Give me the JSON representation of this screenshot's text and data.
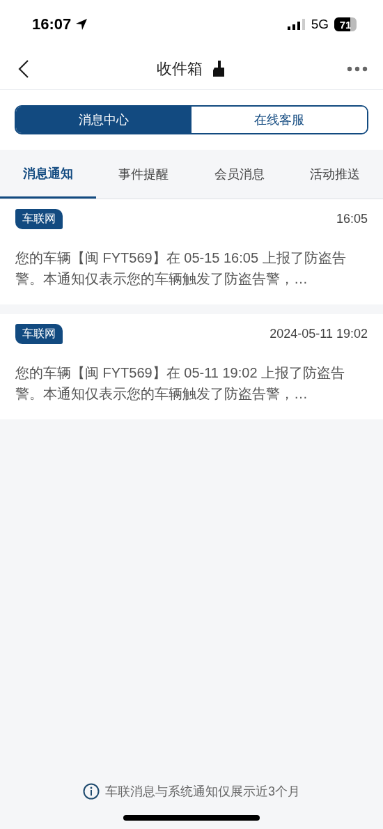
{
  "status_bar": {
    "time": "16:07",
    "network": "5G",
    "battery": "71"
  },
  "header": {
    "title": "收件箱"
  },
  "segments": [
    {
      "label": "消息中心",
      "selected": true
    },
    {
      "label": "在线客服",
      "selected": false
    }
  ],
  "tabs": [
    {
      "label": "消息通知",
      "selected": true
    },
    {
      "label": "事件提醒",
      "selected": false
    },
    {
      "label": "会员消息",
      "selected": false
    },
    {
      "label": "活动推送",
      "selected": false
    }
  ],
  "messages": [
    {
      "tag": "车联网",
      "time": "16:05",
      "text": "您的车辆【闽 FYT569】在 05-15 16:05 上报了防盗告警。本通知仅表示您的车辆触发了防盗告警，…"
    },
    {
      "tag": "车联网",
      "time": "2024-05-11 19:02",
      "text": "您的车辆【闽 FYT569】在 05-11 19:02 上报了防盗告警。本通知仅表示您的车辆触发了防盗告警，…"
    }
  ],
  "footer_note": "车联消息与系统通知仅展示近3个月"
}
